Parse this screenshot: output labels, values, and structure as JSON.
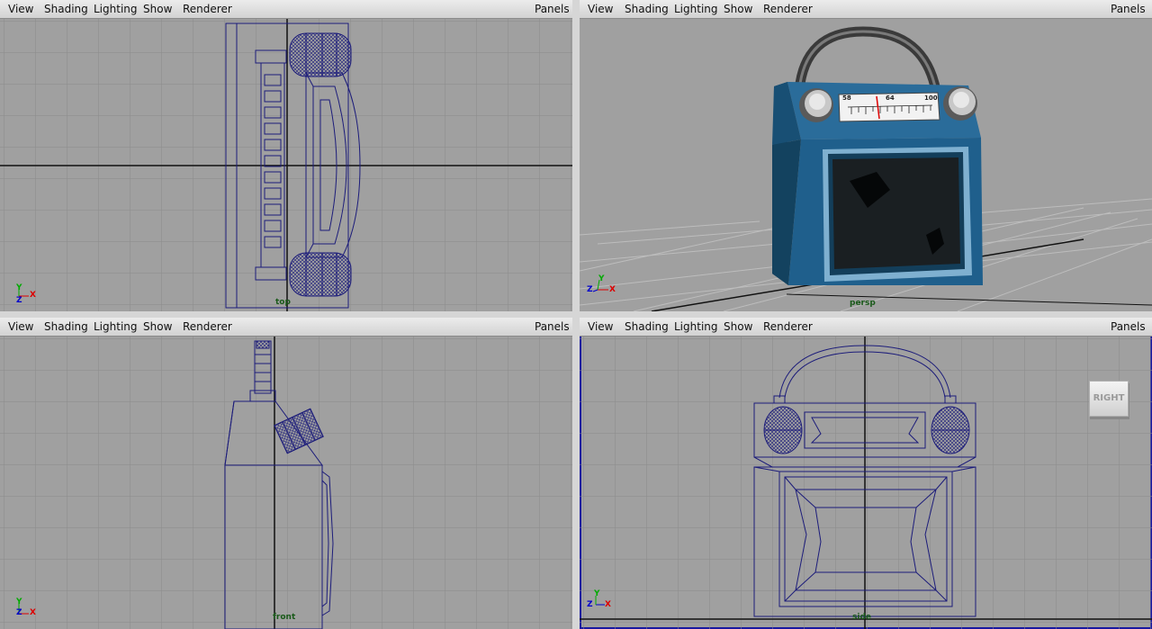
{
  "viewports": {
    "top": {
      "menu": {
        "view": "View",
        "shading": "Shading",
        "lighting": "Lighting",
        "show": "Show",
        "renderer": "Renderer",
        "panels": "Panels"
      },
      "camera": "top"
    },
    "persp": {
      "menu": {
        "view": "View",
        "shading": "Shading",
        "lighting": "Lighting",
        "show": "Show",
        "renderer": "Renderer",
        "panels": "Panels"
      },
      "camera": "persp"
    },
    "front": {
      "menu": {
        "view": "View",
        "shading": "Shading",
        "lighting": "Lighting",
        "show": "Show",
        "renderer": "Renderer",
        "panels": "Panels"
      },
      "camera": "front"
    },
    "side": {
      "menu": {
        "view": "View",
        "shading": "Shading",
        "lighting": "Lighting",
        "show": "Show",
        "renderer": "Renderer",
        "panels": "Panels"
      },
      "camera": "side",
      "viewcube": "RIGHT"
    }
  },
  "axes": {
    "x": "X",
    "y": "Y",
    "z": "Z"
  },
  "dial": {
    "left": "58",
    "mid": "64",
    "right": "100"
  },
  "colors": {
    "viewport_bg": "#a0a0a0",
    "wire": "#1c1c7a",
    "radio_blue": "#1f5f8c",
    "active_border": "#1818a0"
  }
}
